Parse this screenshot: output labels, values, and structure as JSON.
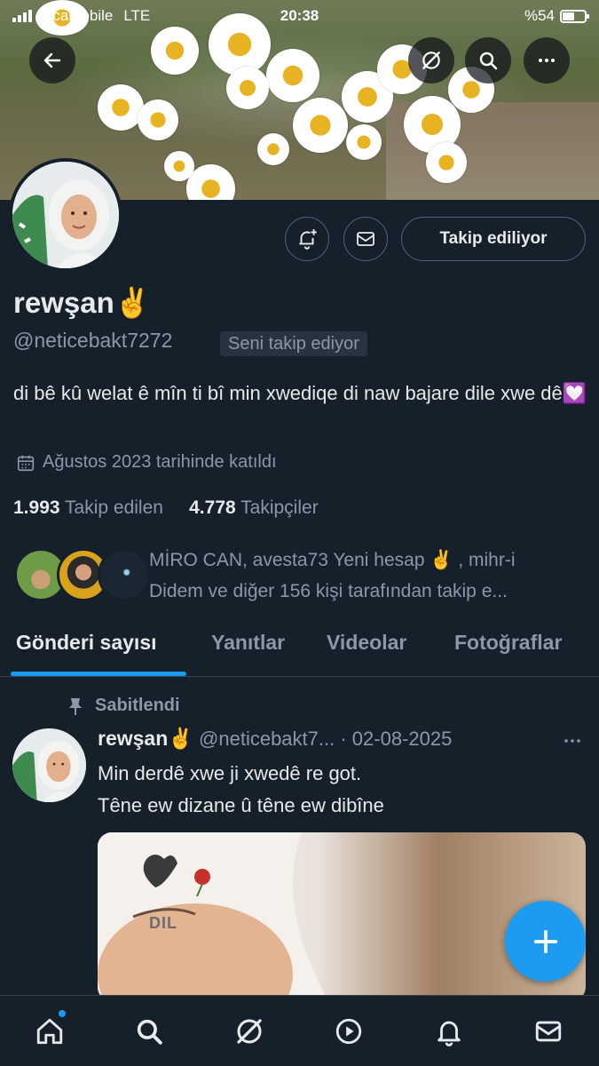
{
  "status_bar": {
    "carrier": "LycaMobile",
    "network": "LTE",
    "time": "20:38",
    "battery": "%54"
  },
  "header_actions": {
    "back_icon": "arrow-left-icon",
    "grok_icon": "grok-icon",
    "search_icon": "search-icon",
    "more_icon": "more-horizontal-icon"
  },
  "profile": {
    "name": "rewşan✌️",
    "handle": "@neticebakt7272",
    "follows_you": "Seni takip ediyor",
    "bio": "di bê kû welat ê mîn ti bî min xwediqe di naw bajare dile xwe dê💟",
    "joined": "Ağustos 2023 tarihinde katıldı",
    "following_count": "1.993",
    "following_label": "Takip edilen",
    "followers_count": "4.778",
    "followers_label": "Takipçiler",
    "follow_button": "Takip ediliyor",
    "mutual_line1": "MİRO CAN, avesta73 Yeni hesap ✌️ , mihr-i",
    "mutual_line2": "Didem ve diğer 156 kişi tarafından takip e..."
  },
  "tabs": [
    {
      "label": "Gönderi sayısı",
      "active": true
    },
    {
      "label": "Yanıtlar",
      "active": false
    },
    {
      "label": "Videolar",
      "active": false
    },
    {
      "label": "Fotoğraflar",
      "active": false
    }
  ],
  "pinned_tweet": {
    "pinned_label": "Sabitlendi",
    "author_name": "rewşan✌️",
    "author_handle": "@neticebakt7...",
    "date": "· 02-08-2025",
    "text_line1": "Min derdê xwe ji xwedê re got.",
    "text_line2": "Têne ew dizane û têne ew dibîne",
    "media_overlay_text": "DIL"
  },
  "bottom_nav": [
    {
      "icon": "home-icon",
      "active": true
    },
    {
      "icon": "search-icon",
      "active": false
    },
    {
      "icon": "grok-icon",
      "active": false
    },
    {
      "icon": "video-play-icon",
      "active": false
    },
    {
      "icon": "bell-icon",
      "active": false
    },
    {
      "icon": "mail-icon",
      "active": false
    }
  ],
  "colors": {
    "background": "#15202b",
    "accent": "#1d9bf0",
    "text_primary": "#e7e9ea",
    "text_secondary": "#8b98a5"
  }
}
